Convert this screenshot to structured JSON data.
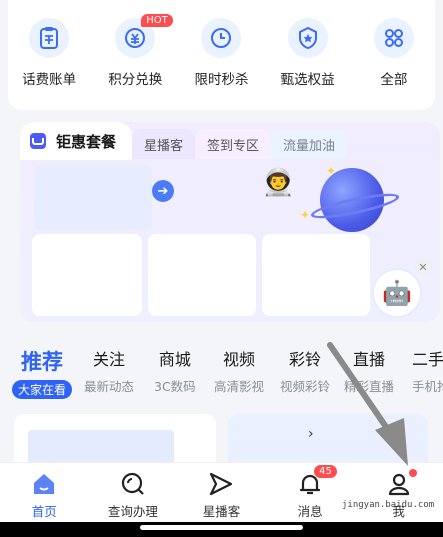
{
  "services": [
    {
      "label": "话费账单",
      "icon": "bill-icon"
    },
    {
      "label": "积分兑换",
      "icon": "points-exchange-icon",
      "badge": "HOT"
    },
    {
      "label": "限时秒杀",
      "icon": "clock-icon"
    },
    {
      "label": "甄选权益",
      "icon": "medal-icon"
    },
    {
      "label": "全部",
      "icon": "grid-icon"
    }
  ],
  "promo": {
    "tabs": [
      "钜惠套餐",
      "星播客",
      "签到专区",
      "流量加油"
    ]
  },
  "channels": [
    {
      "name": "推荐",
      "sub": "大家在看",
      "active": true
    },
    {
      "name": "关注",
      "sub": "最新动态"
    },
    {
      "name": "商城",
      "sub": "3C数码"
    },
    {
      "name": "视频",
      "sub": "高清影视"
    },
    {
      "name": "彩铃",
      "sub": "视频彩铃"
    },
    {
      "name": "直播",
      "sub": "精彩直播"
    },
    {
      "name": "二手",
      "sub": "手机抢"
    }
  ],
  "nav": [
    {
      "label": "首页",
      "icon": "home-icon",
      "active": true
    },
    {
      "label": "查询办理",
      "icon": "search-icon"
    },
    {
      "label": "星播客",
      "icon": "send-icon"
    },
    {
      "label": "消息",
      "icon": "bell-icon",
      "badge": "45"
    },
    {
      "label": "我",
      "icon": "user-icon",
      "dot": true
    }
  ],
  "colors": {
    "accent": "#2e63f5",
    "badge": "#ff4d4f"
  },
  "watermark": "jingyan.baidu.com"
}
